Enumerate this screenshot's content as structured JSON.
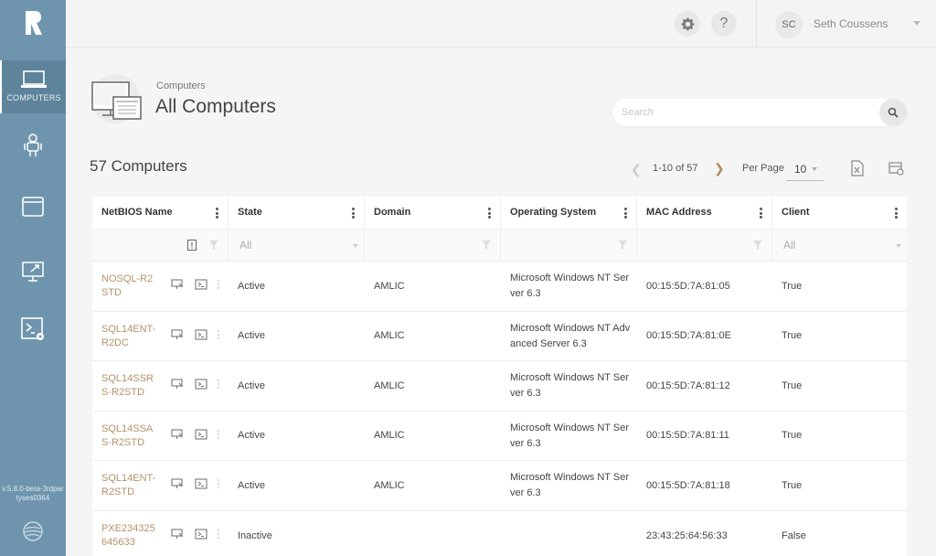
{
  "sidebar": {
    "items": [
      {
        "label": "COMPUTERS",
        "icon": "laptop-icon"
      },
      {
        "label": "",
        "icon": "user-icon"
      },
      {
        "label": "",
        "icon": "window-icon"
      },
      {
        "label": "",
        "icon": "monitor-icon"
      },
      {
        "label": "",
        "icon": "powershell-icon"
      }
    ],
    "version": "v.5.8.0-beta-3rdpartyses0364",
    "accent": "#6e95ad"
  },
  "topbar": {
    "user_initials": "SC",
    "user_name": "Seth Coussens"
  },
  "header": {
    "breadcrumb": "Computers",
    "title": "All Computers",
    "search_placeholder": "Search"
  },
  "toolbar": {
    "count_title": "57 Computers",
    "pager_text": "1-10 of 57",
    "per_page_label": "Per Page",
    "per_page_value": "10"
  },
  "table": {
    "columns": [
      "NetBIOS Name",
      "State",
      "Domain",
      "Operating System",
      "MAC Address",
      "Client"
    ],
    "filters": {
      "state": "All",
      "client": "All"
    },
    "rows": [
      {
        "name": "NOSQL-R2STD",
        "state": "Active",
        "domain": "AMLIC",
        "os": "Microsoft Windows NT Server 6.3",
        "mac": "00:15:5D:7A:81:05",
        "client": "True"
      },
      {
        "name": "SQL14ENT-R2DC",
        "state": "Active",
        "domain": "AMLIC",
        "os": "Microsoft Windows NT Advanced Server 6.3",
        "mac": "00:15:5D:7A:81:0E",
        "client": "True"
      },
      {
        "name": "SQL14SSRS-R2STD",
        "state": "Active",
        "domain": "AMLIC",
        "os": "Microsoft Windows NT Server 6.3",
        "mac": "00:15:5D:7A:81:12",
        "client": "True"
      },
      {
        "name": "SQL14SSAS-R2STD",
        "state": "Active",
        "domain": "AMLIC",
        "os": "Microsoft Windows NT Server 6.3",
        "mac": "00:15:5D:7A:81:11",
        "client": "True"
      },
      {
        "name": "SQL14ENT-R2STD",
        "state": "Active",
        "domain": "AMLIC",
        "os": "Microsoft Windows NT Server 6.3",
        "mac": "00:15:5D:7A:81:18",
        "client": "True"
      },
      {
        "name": "PXE234325645633",
        "state": "Inactive",
        "domain": "",
        "os": "",
        "mac": "23:43:25:64:56:33",
        "client": "False"
      }
    ]
  }
}
